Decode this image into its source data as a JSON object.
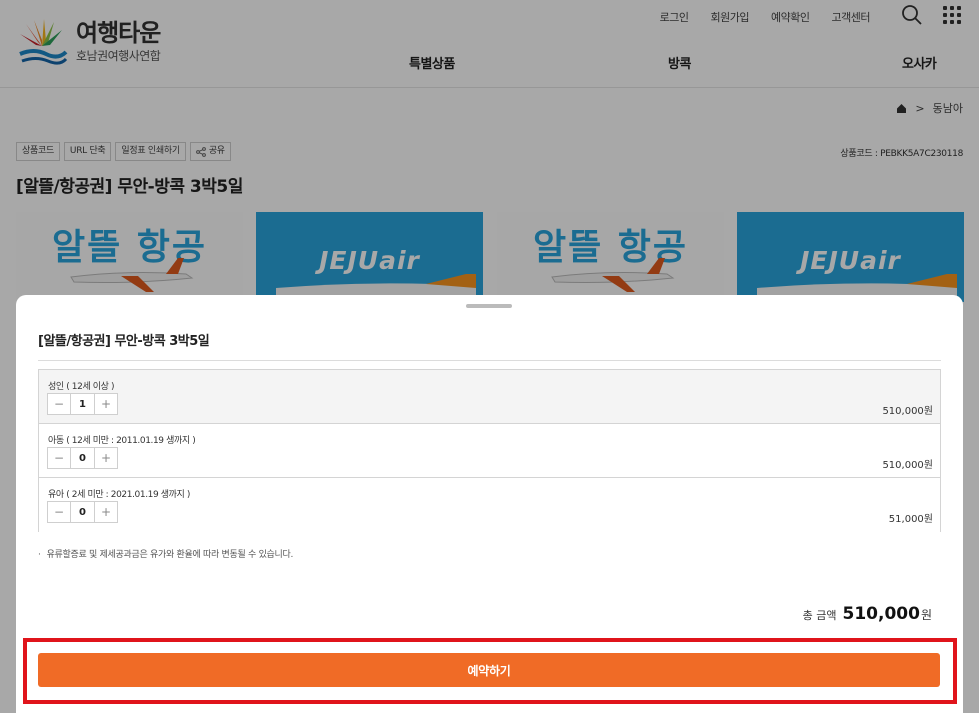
{
  "header": {
    "logo_main": "여행타운",
    "logo_sub": "호남권여행사연합",
    "util_links": [
      "로그인",
      "회원가입",
      "예약확인",
      "고객센터"
    ],
    "nav": [
      "특별상품",
      "방콕",
      "오사카"
    ],
    "icons": [
      "search-icon",
      "grid-menu-icon"
    ]
  },
  "breadcrumb": {
    "home_icon": "home-icon",
    "current": "동남아"
  },
  "product": {
    "chips": [
      "상품코드",
      "URL 단축",
      "일정표 인쇄하기",
      "공유"
    ],
    "code_label": "상품코드 : ",
    "code_value": "PEBKK5A7C230118",
    "title": "[알뜰/항공권] 무안-방콕 3박5일",
    "banner_text_a": "알뜰 항공",
    "banner_text_b": "JEJUair"
  },
  "sheet": {
    "title": "[알뜰/항공권] 무안-방콕 3박5일",
    "options": [
      {
        "label": "성인 ( 12세 이상 )",
        "qty": "1",
        "price": "510,000원"
      },
      {
        "label": "아동 ( 12세 미만 : 2011.01.19 생까지 )",
        "qty": "0",
        "price": "510,000원"
      },
      {
        "label": "유아 ( 2세 미만 : 2021.01.19 생까지 )",
        "qty": "0",
        "price": "51,000원"
      }
    ],
    "stepper_minus": "−",
    "stepper_plus": "+",
    "notice_bullet": "·",
    "notice": "유류할증료 및 제세공과금은 유가와 환율에 따라 변동될 수 있습니다.",
    "total_label": "총 금액",
    "total_amount": "510,000",
    "total_unit": "원",
    "book_label": "예약하기"
  },
  "colors": {
    "accent_orange": "#f06b26",
    "highlight_red": "#e0141b",
    "sky_blue": "#29a5dc"
  }
}
